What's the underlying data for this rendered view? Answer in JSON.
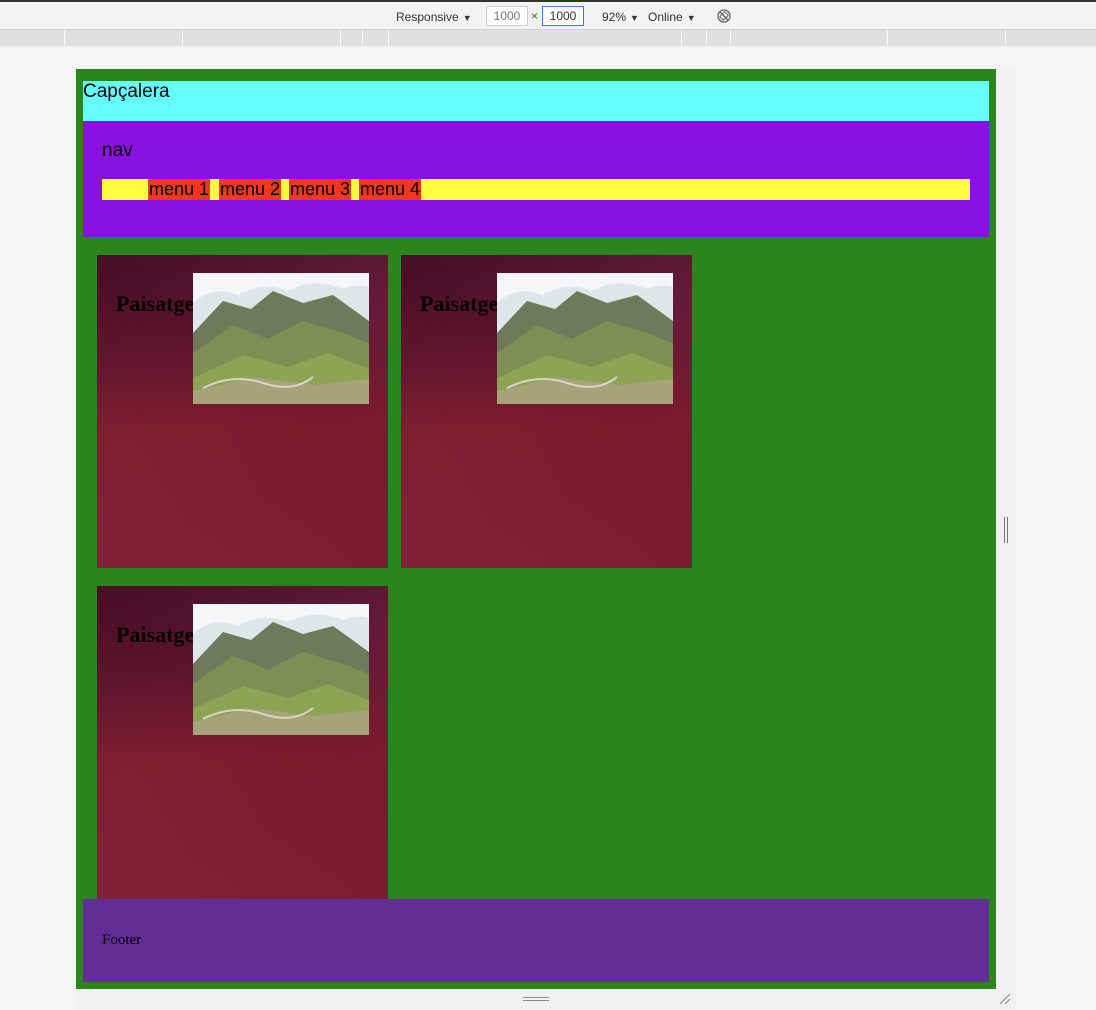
{
  "devtools": {
    "device": "Responsive",
    "width": "1000",
    "height": "1000",
    "dimension_separator": "×",
    "zoom": "92%",
    "throttling": "Online",
    "icons": {
      "dropdown": "caret-down-icon",
      "rotate": "rotate-icon"
    }
  },
  "page": {
    "header": {
      "title": "Capçalera"
    },
    "nav": {
      "label": "nav",
      "menu": [
        "menu 1",
        "menu 2",
        "menu 3",
        "menu 4"
      ]
    },
    "cards": [
      {
        "title": "Paisatge",
        "image": "mountain-landscape-photo"
      },
      {
        "title": "Paisatge",
        "image": "mountain-landscape-photo"
      },
      {
        "title": "Paisatge",
        "image": "mountain-landscape-photo"
      }
    ],
    "footer": {
      "text": "Footer"
    }
  },
  "colors": {
    "page_background": "#2c841c",
    "header": "#66fdfe",
    "nav": "#8a12e0",
    "menu_bar": "#fefe43",
    "menu_item": "#f0391c",
    "card": "#7e1a30",
    "footer": "#622d94"
  }
}
